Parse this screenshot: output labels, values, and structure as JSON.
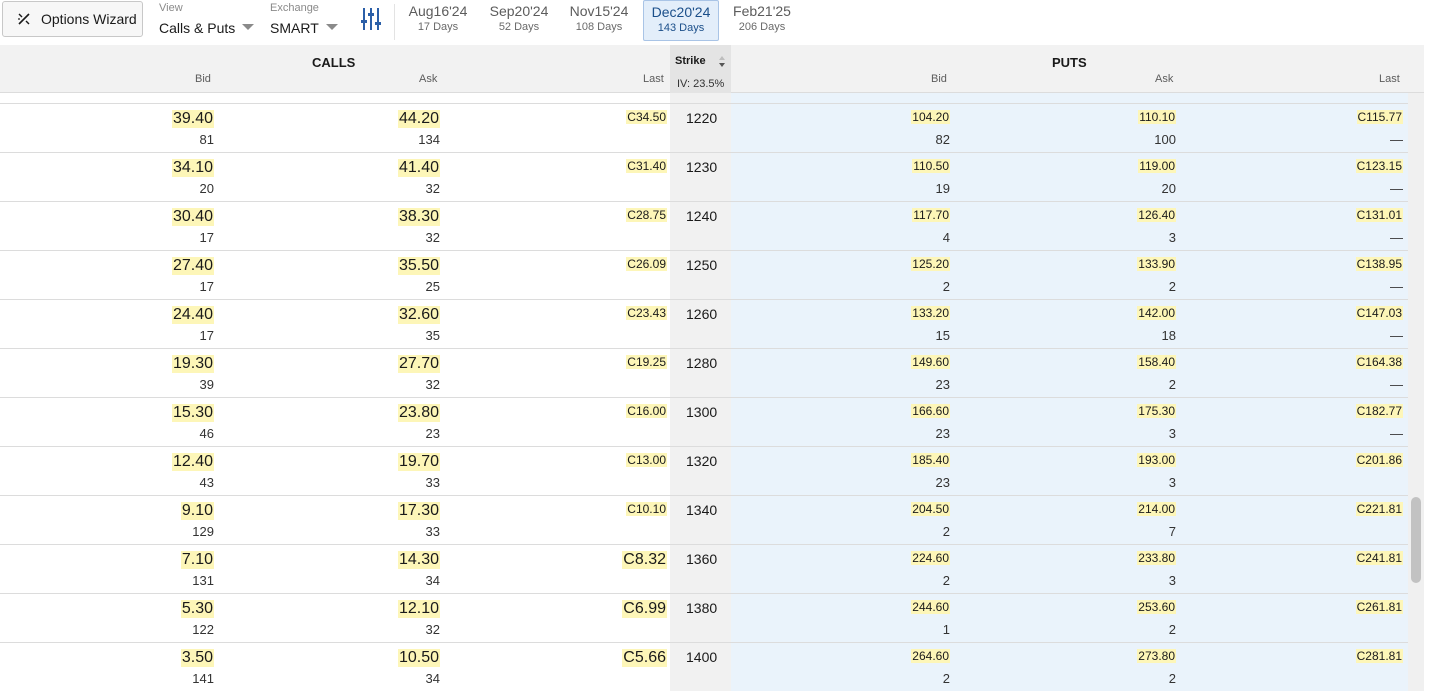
{
  "toolbar": {
    "wizard_label": "Options Wizard",
    "view": {
      "caption": "View",
      "value": "Calls & Puts"
    },
    "exchange": {
      "caption": "Exchange",
      "value": "SMART"
    },
    "expirations": [
      {
        "date": "Aug16'24",
        "days": "17 Days",
        "active": false
      },
      {
        "date": "Sep20'24",
        "days": "52 Days",
        "active": false
      },
      {
        "date": "Nov15'24",
        "days": "108 Days",
        "active": false
      },
      {
        "date": "Dec20'24",
        "days": "143 Days",
        "active": true
      },
      {
        "date": "Feb21'25",
        "days": "206 Days",
        "active": false
      }
    ]
  },
  "header": {
    "calls_title": "CALLS",
    "puts_title": "PUTS",
    "strike_label": "Strike",
    "iv_label": "IV: 23.5%",
    "calls_cols": {
      "bid": "Bid",
      "ask": "Ask",
      "last": "Last"
    },
    "puts_cols": {
      "bid": "Bid",
      "ask": "Ask",
      "last": "Last"
    }
  },
  "rows": [
    {
      "strike": "1220",
      "call_bid": "39.40",
      "call_bid_size": "81",
      "call_ask": "44.20",
      "call_ask_size": "134",
      "call_last": "C34.50",
      "put_bid": "104.20",
      "put_bid_size": "82",
      "put_ask": "110.10",
      "put_ask_size": "100",
      "put_last": "C115.77",
      "put_last_chg": "—"
    },
    {
      "strike": "1230",
      "call_bid": "34.10",
      "call_bid_size": "20",
      "call_ask": "41.40",
      "call_ask_size": "32",
      "call_last": "C31.40",
      "put_bid": "110.50",
      "put_bid_size": "19",
      "put_ask": "119.00",
      "put_ask_size": "20",
      "put_last": "C123.15",
      "put_last_chg": "—"
    },
    {
      "strike": "1240",
      "call_bid": "30.40",
      "call_bid_size": "17",
      "call_ask": "38.30",
      "call_ask_size": "32",
      "call_last": "C28.75",
      "put_bid": "117.70",
      "put_bid_size": "4",
      "put_ask": "126.40",
      "put_ask_size": "3",
      "put_last": "C131.01",
      "put_last_chg": "—"
    },
    {
      "strike": "1250",
      "call_bid": "27.40",
      "call_bid_size": "17",
      "call_ask": "35.50",
      "call_ask_size": "25",
      "call_last": "C26.09",
      "put_bid": "125.20",
      "put_bid_size": "2",
      "put_ask": "133.90",
      "put_ask_size": "2",
      "put_last": "C138.95",
      "put_last_chg": "—"
    },
    {
      "strike": "1260",
      "call_bid": "24.40",
      "call_bid_size": "17",
      "call_ask": "32.60",
      "call_ask_size": "35",
      "call_last": "C23.43",
      "put_bid": "133.20",
      "put_bid_size": "15",
      "put_ask": "142.00",
      "put_ask_size": "18",
      "put_last": "C147.03",
      "put_last_chg": "—"
    },
    {
      "strike": "1280",
      "call_bid": "19.30",
      "call_bid_size": "39",
      "call_ask": "27.70",
      "call_ask_size": "32",
      "call_last": "C19.25",
      "put_bid": "149.60",
      "put_bid_size": "23",
      "put_ask": "158.40",
      "put_ask_size": "2",
      "put_last": "C164.38",
      "put_last_chg": "—"
    },
    {
      "strike": "1300",
      "call_bid": "15.30",
      "call_bid_size": "46",
      "call_ask": "23.80",
      "call_ask_size": "23",
      "call_last": "C16.00",
      "put_bid": "166.60",
      "put_bid_size": "23",
      "put_ask": "175.30",
      "put_ask_size": "3",
      "put_last": "C182.77",
      "put_last_chg": "—"
    },
    {
      "strike": "1320",
      "call_bid": "12.40",
      "call_bid_size": "43",
      "call_ask": "19.70",
      "call_ask_size": "33",
      "call_last": "C13.00",
      "put_bid": "185.40",
      "put_bid_size": "23",
      "put_ask": "193.00",
      "put_ask_size": "3",
      "put_last": "C201.86",
      "put_last_chg": ""
    },
    {
      "strike": "1340",
      "call_bid": "9.10",
      "call_bid_size": "129",
      "call_ask": "17.30",
      "call_ask_size": "33",
      "call_last": "C10.10",
      "put_bid": "204.50",
      "put_bid_size": "2",
      "put_ask": "214.00",
      "put_ask_size": "7",
      "put_last": "C221.81",
      "put_last_chg": ""
    },
    {
      "strike": "1360",
      "call_bid": "7.10",
      "call_bid_size": "131",
      "call_ask": "14.30",
      "call_ask_size": "34",
      "call_last": "C8.32",
      "put_bid": "224.60",
      "put_bid_size": "2",
      "put_ask": "233.80",
      "put_ask_size": "3",
      "put_last": "C241.81",
      "put_last_chg": ""
    },
    {
      "strike": "1380",
      "call_bid": "5.30",
      "call_bid_size": "122",
      "call_ask": "12.10",
      "call_ask_size": "32",
      "call_last": "C6.99",
      "put_bid": "244.60",
      "put_bid_size": "1",
      "put_ask": "253.60",
      "put_ask_size": "2",
      "put_last": "C261.81",
      "put_last_chg": ""
    },
    {
      "strike": "1400",
      "call_bid": "3.50",
      "call_bid_size": "141",
      "call_ask": "10.50",
      "call_ask_size": "34",
      "call_last": "C5.66",
      "put_bid": "264.60",
      "put_bid_size": "2",
      "put_ask": "273.80",
      "put_ask_size": "2",
      "put_last": "C281.81",
      "put_last_chg": ""
    }
  ],
  "colors": {
    "highlight": "#fdf6b8",
    "puts_bg": "#eaf3fb",
    "active_tab": "#e3eefa"
  }
}
